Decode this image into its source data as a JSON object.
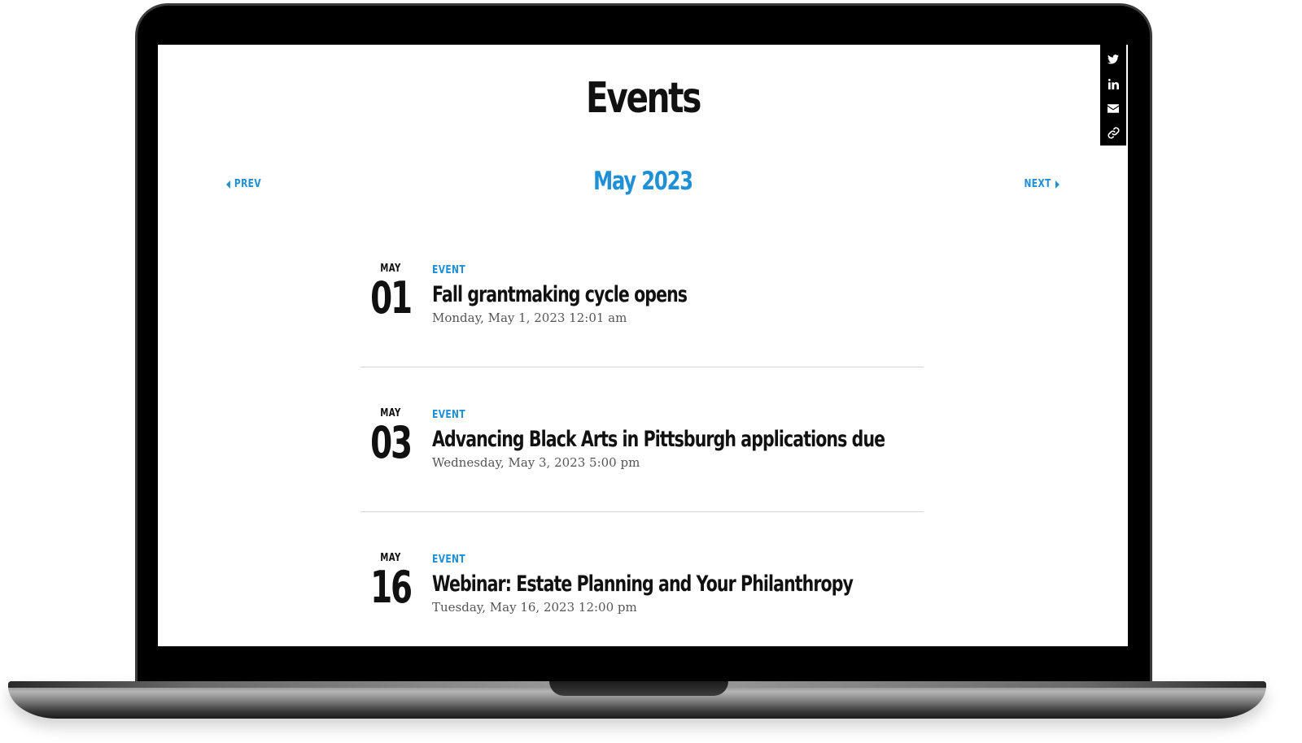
{
  "page": {
    "title": "Events"
  },
  "share": {
    "icons": [
      "twitter-icon",
      "linkedin-icon",
      "email-icon",
      "link-icon"
    ]
  },
  "month_nav": {
    "prev_label": "PREV",
    "next_label": "NEXT",
    "current": "May 2023"
  },
  "events": [
    {
      "month": "MAY",
      "day": "01",
      "tag": "EVENT",
      "title": "Fall grantmaking cycle opens",
      "datetime": "Monday, May 1, 2023 12:01 am"
    },
    {
      "month": "MAY",
      "day": "03",
      "tag": "EVENT",
      "title": "Advancing Black Arts in Pittsburgh applications due",
      "datetime": "Wednesday, May 3, 2023 5:00 pm"
    },
    {
      "month": "MAY",
      "day": "16",
      "tag": "EVENT",
      "title": "Webinar: Estate Planning and Your Philanthropy",
      "datetime": "Tuesday, May 16, 2023 12:00 pm"
    }
  ],
  "colors": {
    "accent": "#1f8fd6",
    "text": "#111111",
    "muted": "#555555",
    "divider": "#d4d4d4"
  }
}
